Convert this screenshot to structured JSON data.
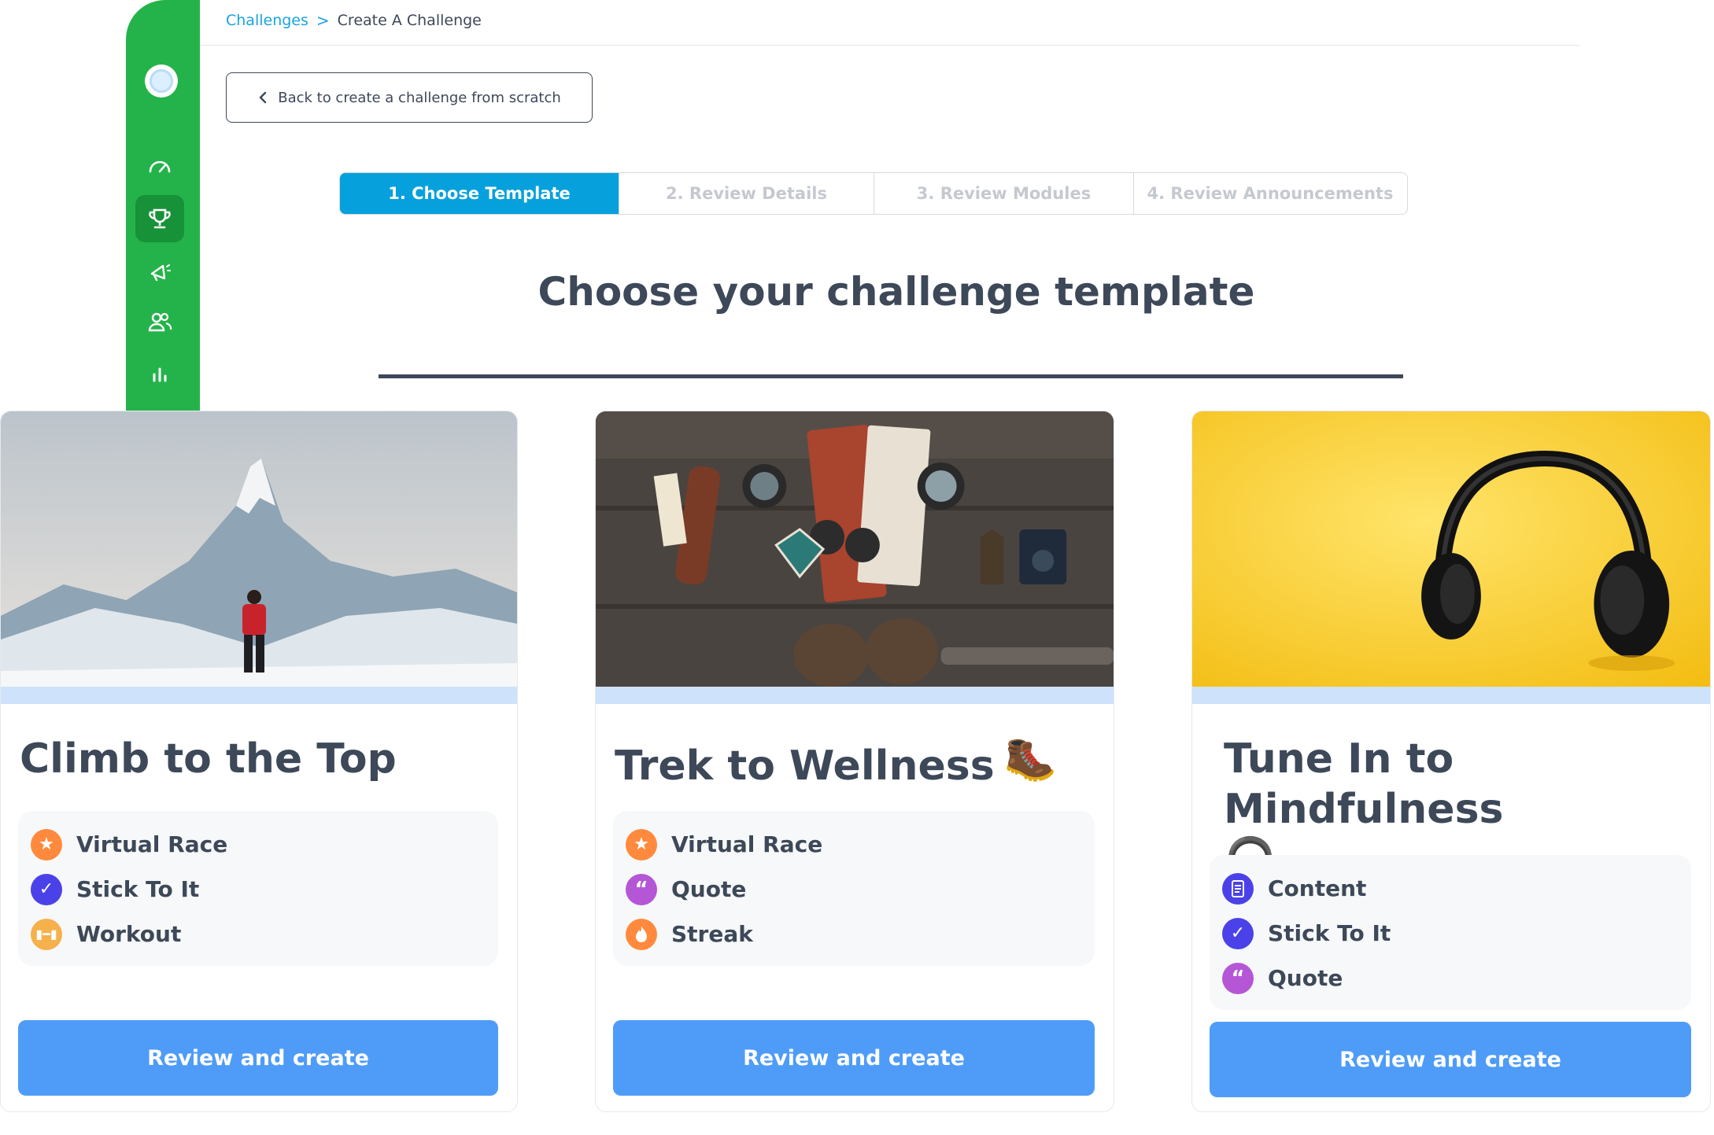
{
  "breadcrumb": {
    "parent": "Challenges",
    "separator": ">",
    "current": "Create A Challenge"
  },
  "back_button": {
    "label": "Back to create a challenge from scratch"
  },
  "stepper": {
    "steps": [
      "1. Choose Template",
      "2. Review Details",
      "3. Review Modules",
      "4. Review Announcements"
    ],
    "active_step": 1
  },
  "page_title": "Choose your challenge template",
  "cards": [
    {
      "title": "Climb to the Top",
      "title_emoji": "",
      "modules": [
        {
          "label": "Virtual Race",
          "icon": "star-icon",
          "color": "#ff8a3d"
        },
        {
          "label": "Stick To It",
          "icon": "checkmark-icon",
          "color": "#4a42e8"
        },
        {
          "label": "Workout",
          "icon": "dumbbell-icon",
          "color": "#f6b04c"
        }
      ],
      "cta": "Review and create"
    },
    {
      "title": "Trek to Wellness",
      "title_emoji": "🥾",
      "modules": [
        {
          "label": "Virtual Race",
          "icon": "star-icon",
          "color": "#ff8a3d"
        },
        {
          "label": "Quote",
          "icon": "quote-icon",
          "color": "#b456d6"
        },
        {
          "label": "Streak",
          "icon": "flame-icon",
          "color": "#ff8a3d"
        }
      ],
      "cta": "Review and create"
    },
    {
      "title": "Tune In to Mindfulness",
      "title_emoji": "🎧",
      "modules": [
        {
          "label": "Content",
          "icon": "document-icon",
          "color": "#4a42e8"
        },
        {
          "label": "Stick To It",
          "icon": "checkmark-icon",
          "color": "#4a42e8"
        },
        {
          "label": "Quote",
          "icon": "quote-icon",
          "color": "#b456d6"
        }
      ],
      "cta": "Review and create"
    }
  ],
  "colors": {
    "sidebar": "#24b34b",
    "sidebar_active": "#179238",
    "stepper_active": "#06a1dd",
    "cta": "#4e9cf8",
    "link": "#1aa3dd",
    "text": "#3d4858"
  }
}
